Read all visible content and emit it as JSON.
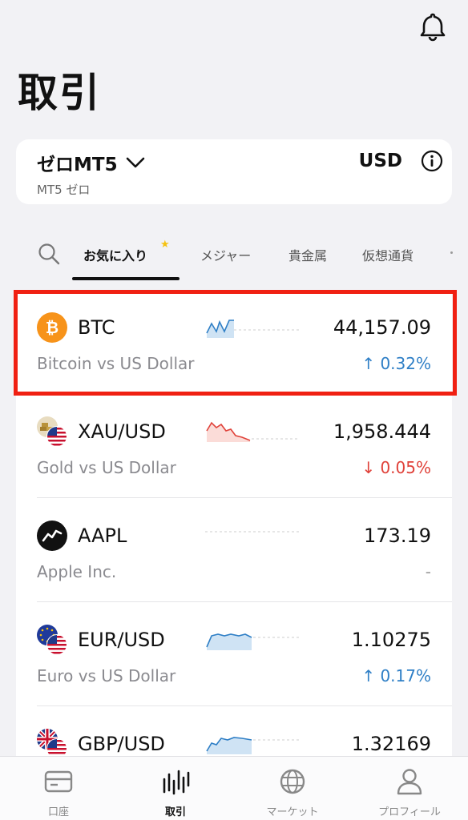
{
  "header": {
    "title": "取引",
    "bell_icon": "bell-icon"
  },
  "account": {
    "name": "ゼロMT5",
    "subtitle": "MT5 ゼロ",
    "currency": "USD",
    "info_icon": "info-icon"
  },
  "tabs": {
    "search_icon": "search-icon",
    "items": [
      {
        "label": "お気に入り",
        "active": true
      },
      {
        "label": "メジャー"
      },
      {
        "label": "貴金属"
      },
      {
        "label": "仮想通貨"
      }
    ]
  },
  "instruments": [
    {
      "symbol": "BTC",
      "desc": "Bitcoin vs US Dollar",
      "price": "44,157.09",
      "change": "↑ 0.32%",
      "direction": "up",
      "color": "#2f7fc6"
    },
    {
      "symbol": "XAU/USD",
      "desc": "Gold vs US Dollar",
      "price": "1,958.444",
      "change": "↓ 0.05%",
      "direction": "down",
      "color": "#e0423a"
    },
    {
      "symbol": "AAPL",
      "desc": "Apple Inc.",
      "price": "173.19",
      "change": "-",
      "direction": "neutral"
    },
    {
      "symbol": "EUR/USD",
      "desc": "Euro vs US Dollar",
      "price": "1.10275",
      "change": "↑ 0.17%",
      "direction": "up",
      "color": "#2f7fc6"
    },
    {
      "symbol": "GBP/USD",
      "desc": "",
      "price": "1.32169",
      "change": "",
      "direction": "up",
      "color": "#2f7fc6"
    }
  ],
  "bottom_nav": [
    {
      "label": "口座",
      "icon": "wallet-icon"
    },
    {
      "label": "取引",
      "icon": "chart-bars-icon",
      "active": true
    },
    {
      "label": "マーケット",
      "icon": "globe-icon"
    },
    {
      "label": "プロフィール",
      "icon": "person-icon"
    }
  ],
  "colors": {
    "highlight": "#f02012",
    "up": "#2f7fc6",
    "down": "#e0423a",
    "btc": "#f7931a"
  }
}
